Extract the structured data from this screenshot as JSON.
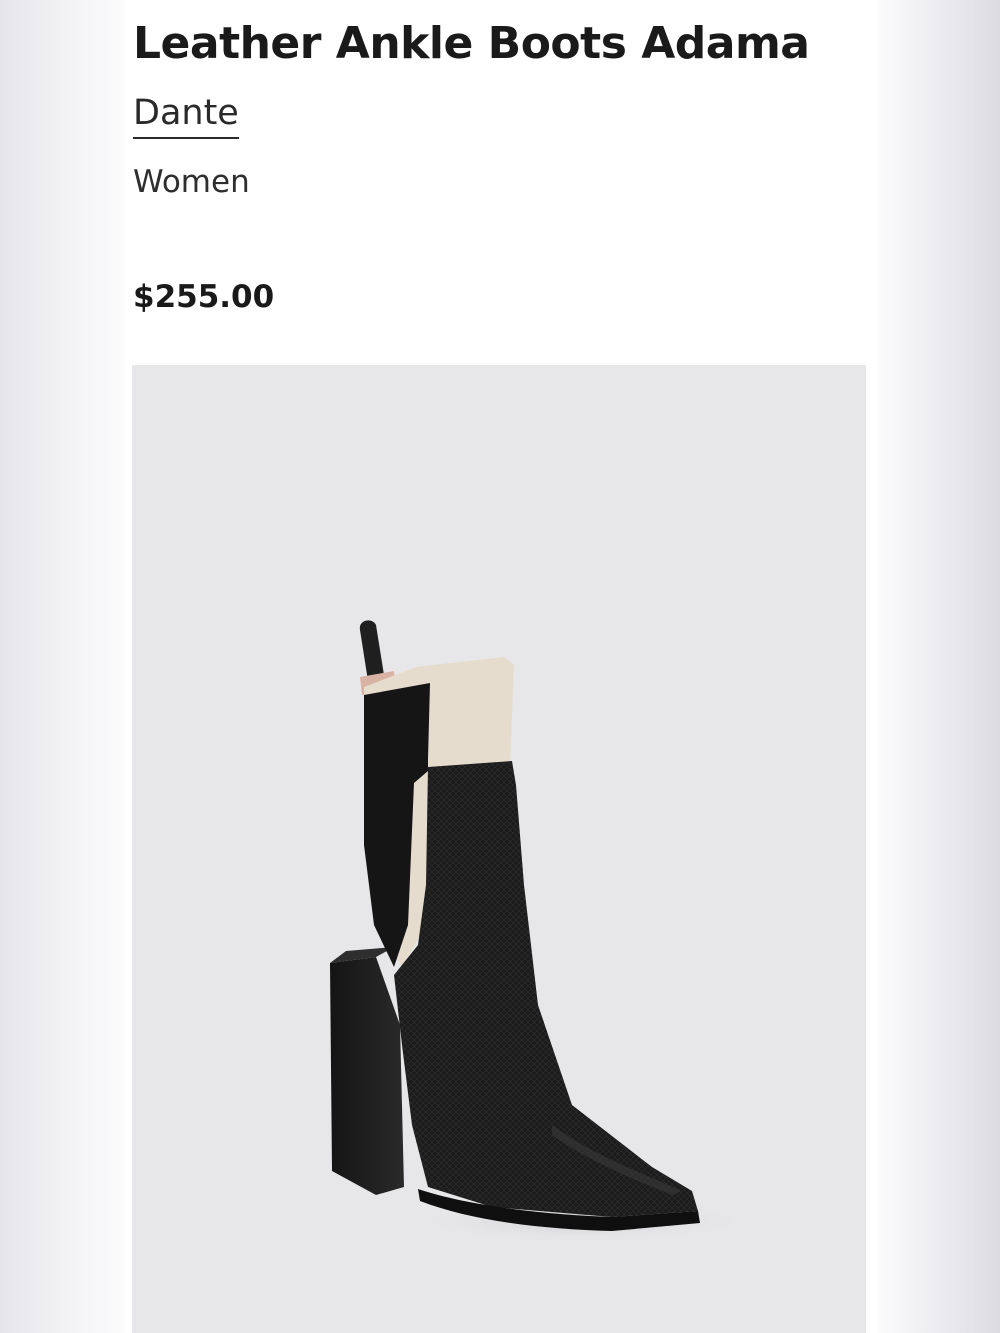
{
  "product": {
    "title": "Leather Ankle Boots Adama",
    "brand": "Dante",
    "category": "Women",
    "price": "$255.00"
  },
  "image": {
    "subject": "boot-photo",
    "colors": {
      "background": "#e7e7e9",
      "leather": "#1b1b1b",
      "panel": "#e5dccd"
    }
  }
}
